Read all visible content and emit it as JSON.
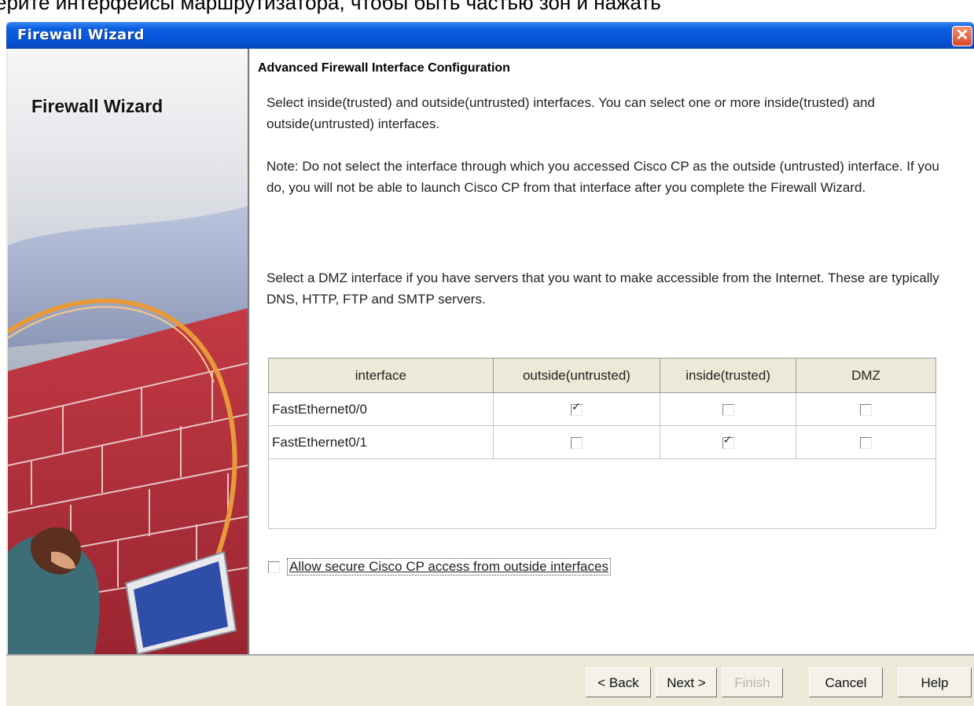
{
  "caption": "ерите интерфейсы маршрутизатора, чтобы быть частью зон и нажать",
  "window": {
    "title": "Firewall Wizard",
    "close_symbol": "✕"
  },
  "sidebar": {
    "title": "Firewall Wizard"
  },
  "page": {
    "heading": "Advanced Firewall Interface Configuration",
    "instruction1": "Select inside(trusted) and outside(untrusted) interfaces. You can select one or more inside(trusted) and outside(untrusted) interfaces.",
    "note": "Note: Do not select the interface through which you accessed Cisco CP as the outside (untrusted) interface. If you do, you will not be able to launch Cisco CP from that interface after you complete the Firewall Wizard.",
    "instruction2": "Select a DMZ interface if you have servers that you want to make accessible from the Internet. These are typically DNS, HTTP, FTP and SMTP servers."
  },
  "table": {
    "columns": [
      "interface",
      "outside(untrusted)",
      "inside(trusted)",
      "DMZ"
    ],
    "rows": [
      {
        "interface": "FastEthernet0/0",
        "outside": true,
        "inside": false,
        "dmz": false
      },
      {
        "interface": "FastEthernet0/1",
        "outside": false,
        "inside": true,
        "dmz": false
      }
    ]
  },
  "allow_access": {
    "label": "Allow secure Cisco CP access from outside interfaces",
    "checked": false
  },
  "buttons": {
    "back": "< Back",
    "next": "Next >",
    "finish": "Finish",
    "cancel": "Cancel",
    "help": "Help"
  },
  "icons": {
    "close": "close-icon",
    "checkbox_checked": "checkmark-icon"
  }
}
